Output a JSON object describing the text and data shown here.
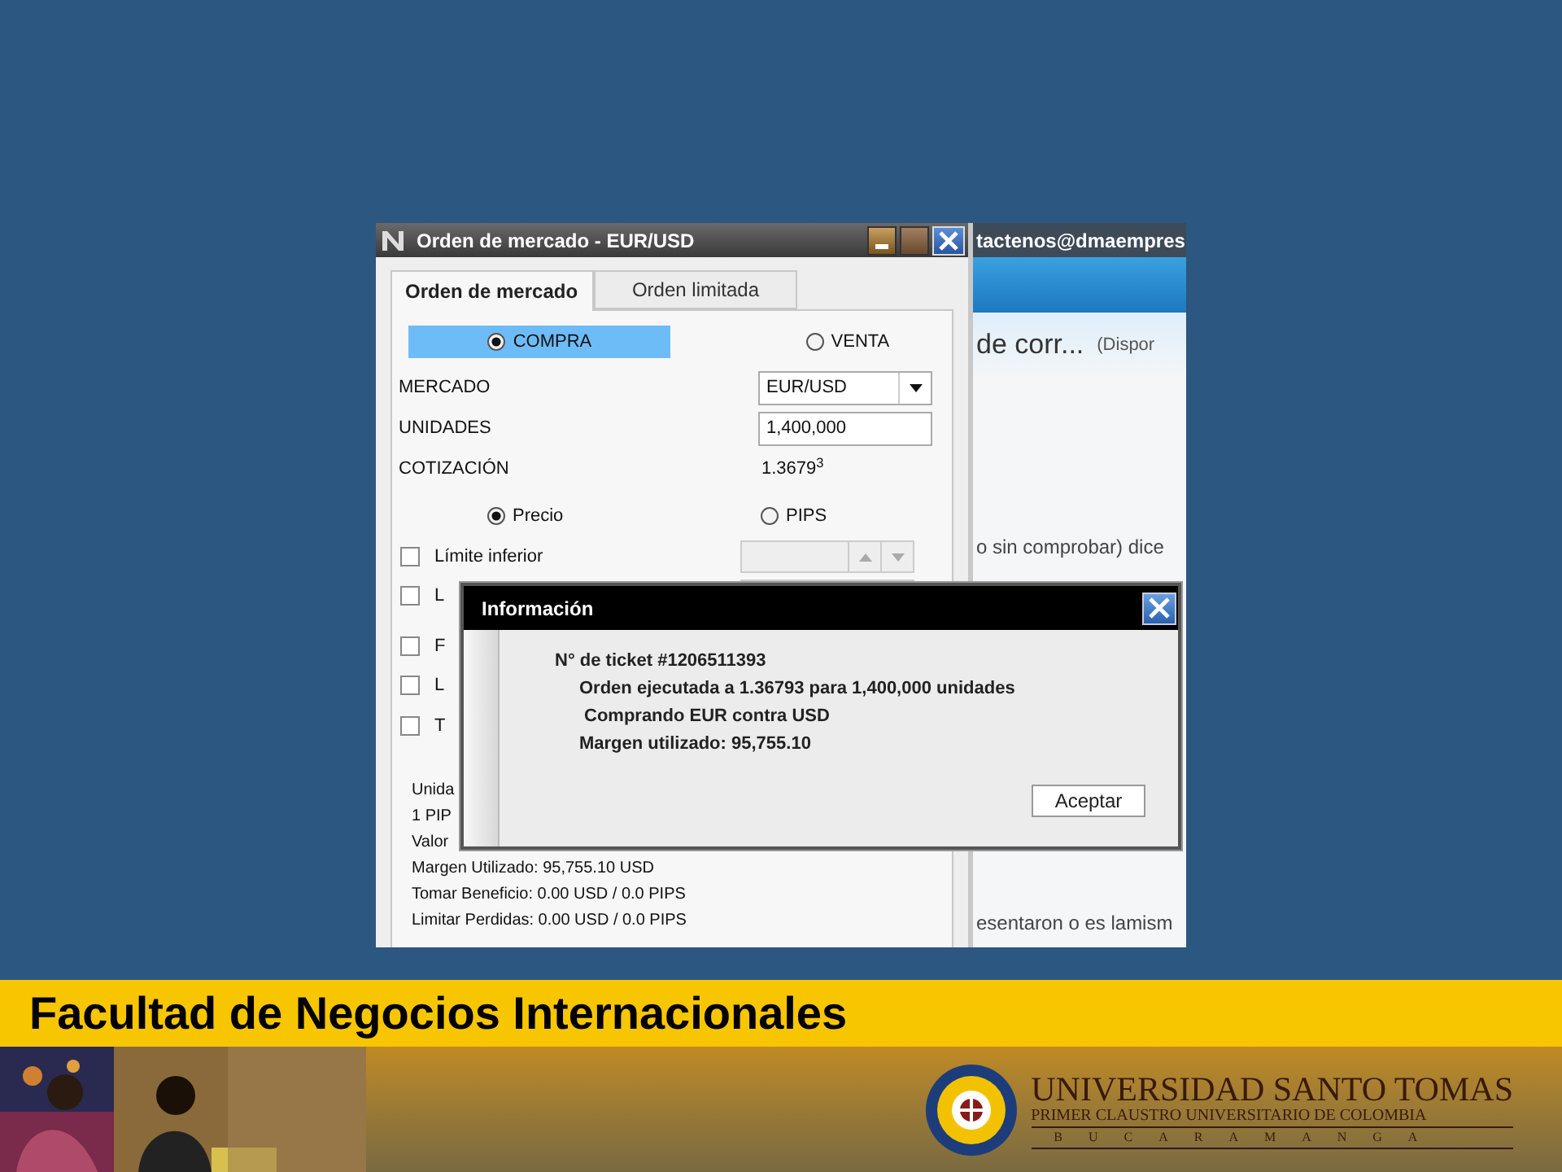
{
  "window": {
    "title": "Orden de mercado - EUR/USD",
    "tabs": [
      {
        "label": "Orden de mercado",
        "selected": true
      },
      {
        "label": "Orden limitada",
        "selected": false
      }
    ],
    "side_options": [
      {
        "label": "COMPRA",
        "selected": true
      },
      {
        "label": "VENTA",
        "selected": false
      }
    ],
    "fields": [
      {
        "kind": "dropdown",
        "label": "MERCADO",
        "value": "EUR/USD"
      },
      {
        "kind": "input",
        "label": "UNIDADES",
        "value": "1,400,000"
      },
      {
        "kind": "text",
        "label": "COTIZACIÓN",
        "value": "1.3679$^{3}$"
      }
    ],
    "mode_options": [
      {
        "label": "Precio",
        "selected": true
      },
      {
        "label": "PIPS",
        "selected": false
      }
    ],
    "checkboxes": [
      {
        "kind": "spinner",
        "label": "Límite inferior",
        "checked": false
      },
      {
        "kind": "spinner",
        "label": "L",
        "checked": false
      },
      {
        "kind": "plain",
        "label": "F",
        "checked": false
      },
      {
        "kind": "plain",
        "label": "L",
        "checked": false
      },
      {
        "kind": "plain",
        "label": "T",
        "checked": false
      }
    ],
    "summary": [
      "Unida",
      "1 PIP",
      "Valor",
      "Margen Utilizado: 95,755.10 USD",
      "Tomar Beneficio: 0.00 USD / 0.0 PIPS",
      "Limitar Perdidas: 0.00 USD / 0.0 PIPS"
    ]
  },
  "background_page": {
    "texts": [
      "tactenos@dmaempres",
      "de corr...",
      "(Dispor",
      "o sin comprobar) dice",
      "esentaron o es lamism"
    ]
  },
  "dialog": {
    "title": "Información",
    "lines": [
      "N° de ticket #1206511393",
      "Orden ejecutada a 1.36793 para 1,400,000 unidades",
      "Comprando EUR contra USD",
      "Margen utilizado: 95,755.10"
    ],
    "button": "Aceptar"
  },
  "slide": {
    "footer_title": "Facultad de Negocios Internacionales",
    "logo": {
      "name": "UNIVERSIDAD SANTO TOMAS",
      "motto": "PRIMER CLAUSTRO UNIVERSITARIO DE COLOMBIA",
      "city": "BUCARAMANGA"
    }
  }
}
